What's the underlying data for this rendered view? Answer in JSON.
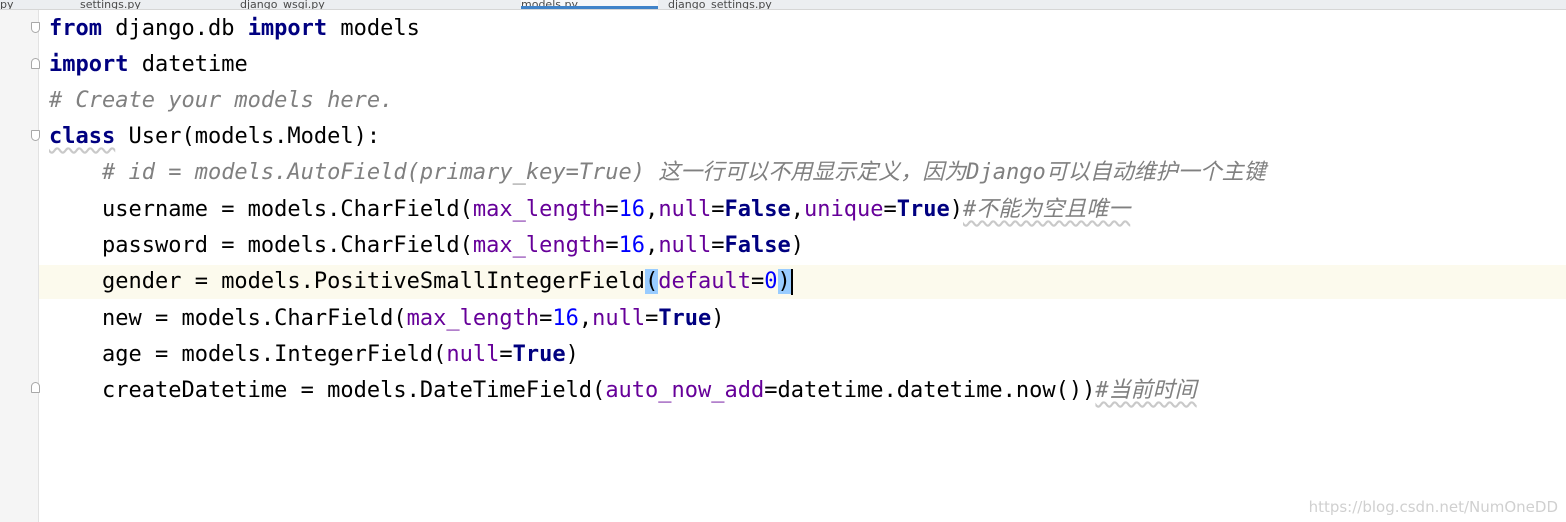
{
  "tabs": [
    {
      "label": "py"
    },
    {
      "label": "settings.py"
    },
    {
      "label": "django_wsgi.py"
    },
    {
      "label": "models.py"
    },
    {
      "label": "django_settings.py"
    }
  ],
  "code": {
    "l1": {
      "from": "from",
      "mod": " django.db ",
      "import": "import",
      "name": " models"
    },
    "l2": {
      "import": "import",
      "name": " datetime"
    },
    "l3": {
      "comment": "# Create your models here."
    },
    "l4": {
      "class": "class",
      "name": " User",
      "rest": "(models.Model):"
    },
    "l5": {
      "indent": "    ",
      "comment": "# id = models.AutoField(primary_key=True) 这一行可以不用显示定义，因为Django可以自动维护一个主键"
    },
    "l6": {
      "indent": "    ",
      "pre": "username = models.CharField(",
      "kw1": "max_length",
      "eq1": "=",
      "num1": "16",
      "c1": ",",
      "kw2": "null",
      "eq2": "=",
      "val2": "False",
      "c2": ",",
      "kw3": "unique",
      "eq3": "=",
      "val3": "True",
      "close": ")",
      "comment": "#不能为空且唯一"
    },
    "l7": {
      "indent": "    ",
      "pre": "password = models.CharField(",
      "kw1": "max_length",
      "eq1": "=",
      "num1": "16",
      "c1": ",",
      "kw2": "null",
      "eq2": "=",
      "val2": "False",
      "close": ")"
    },
    "l8": {
      "indent": "    ",
      "pre": "gender = models.PositiveSmallIntegerField",
      "open": "(",
      "kw1": "default",
      "eq1": "=",
      "num1": "0",
      "close": ")"
    },
    "l9": {
      "indent": "    ",
      "pre": "new = models.CharField(",
      "kw1": "max_length",
      "eq1": "=",
      "num1": "16",
      "c1": ",",
      "kw2": "null",
      "eq2": "=",
      "val2": "True",
      "close": ")"
    },
    "l10": {
      "indent": "    ",
      "pre": "age = models.IntegerField(",
      "kw1": "null",
      "eq1": "=",
      "val1": "True",
      "close": ")"
    },
    "l11": {
      "indent": "    ",
      "pre": "createDatetime = models.DateTimeField(",
      "kw1": "auto_now_add",
      "rest": "=datetime.datetime.now())",
      "comment": "#当前时间"
    }
  },
  "watermark": "https://blog.csdn.net/NumOneDD"
}
